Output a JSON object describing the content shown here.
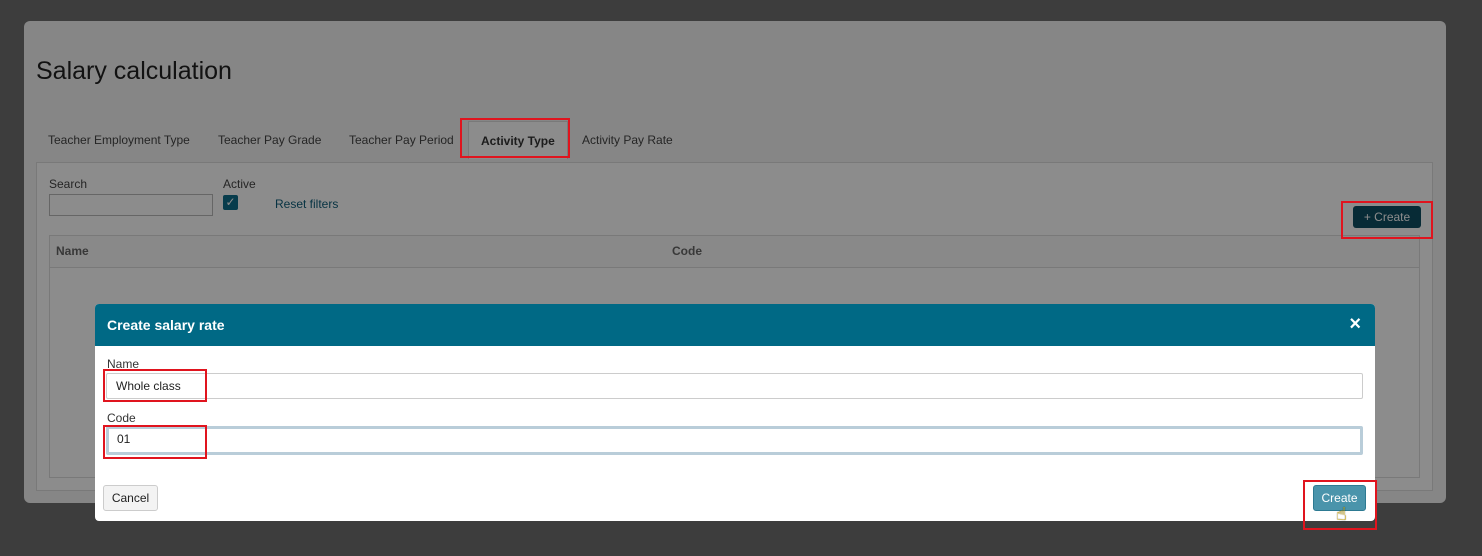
{
  "page": {
    "title": "Salary calculation",
    "tabs": [
      {
        "label": "Teacher Employment Type"
      },
      {
        "label": "Teacher Pay Grade"
      },
      {
        "label": "Teacher Pay Period"
      },
      {
        "label": "Activity Type",
        "active": true
      },
      {
        "label": "Activity Pay Rate"
      }
    ],
    "filters": {
      "search_label": "Search",
      "search_value": "",
      "active_label": "Active",
      "active_checked": true,
      "reset_label": "Reset filters"
    },
    "create_button": "+ Create",
    "table": {
      "columns": [
        "Name",
        "Code"
      ]
    }
  },
  "modal": {
    "title": "Create salary rate",
    "close_glyph": "×",
    "name_label": "Name",
    "name_value": "Whole class",
    "code_label": "Code",
    "code_value": "01",
    "cancel_label": "Cancel",
    "create_label": "Create"
  },
  "colors": {
    "header": "#006985",
    "annotation": "#e0141e",
    "create_button": "#4a94ab"
  }
}
